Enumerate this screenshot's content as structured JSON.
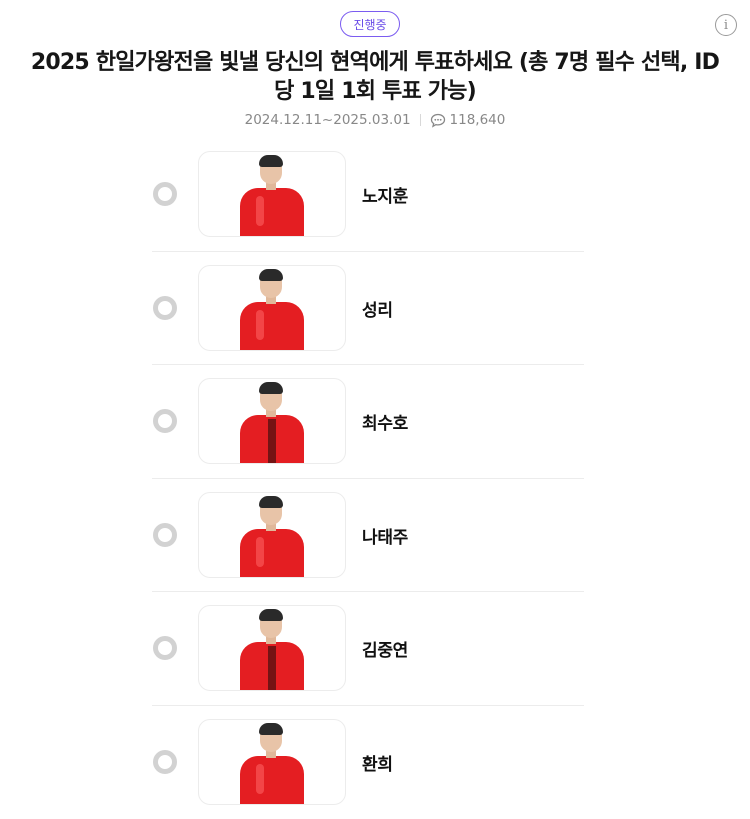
{
  "status_badge": "진행중",
  "info_icon": "info-icon",
  "title": "2025 한일가왕전을 빛낼 당신의 현역에게 투표하세요 (총 7명 필수 선택, ID 당 1일 1회 투표 가능)",
  "date_range": "2024.12.11~2025.03.01",
  "comment_count": "118,640",
  "colors": {
    "accent": "#6a4ce8",
    "costume": "#e41e22"
  },
  "candidates": [
    {
      "name": "노지훈"
    },
    {
      "name": "성리"
    },
    {
      "name": "최수호"
    },
    {
      "name": "나태주"
    },
    {
      "name": "김중연"
    },
    {
      "name": "환희"
    }
  ]
}
